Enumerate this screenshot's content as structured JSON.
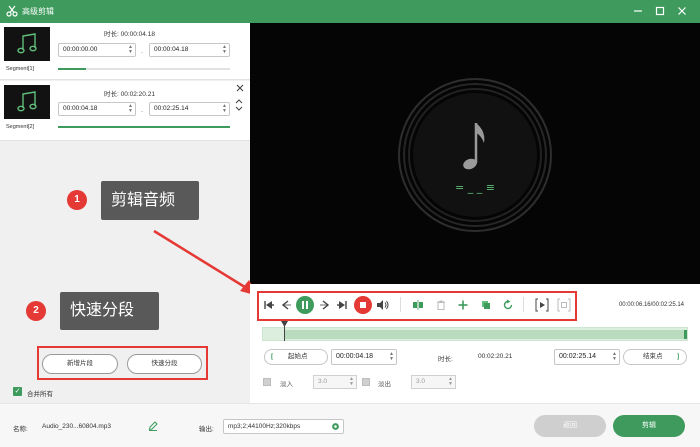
{
  "window": {
    "title": "高级剪辑"
  },
  "segments": [
    {
      "label": "Segment[1]",
      "duration_label": "时长: 00:00:04.18",
      "start": "00:00:00.00",
      "end": "00:00:04.18"
    },
    {
      "label": "Segment[2]",
      "duration_label": "时长: 00:02:20.21",
      "start": "00:00:04.18",
      "end": "00:02:25.14"
    }
  ],
  "annotations": {
    "callout1_number": "1",
    "callout1_text": "剪辑音频",
    "callout2_number": "2",
    "callout2_text": "快速分段"
  },
  "left_actions": {
    "add_segment": "新增片段",
    "quick_split": "快速分段",
    "merge_all": "合并所有"
  },
  "player": {
    "time_counter": "00:00:06.16/00:02:25.14",
    "note_bars": "= _ _ ≡"
  },
  "trim": {
    "start_point": "起始点",
    "start_value": "00:00:04.18",
    "duration_label": "时长:",
    "duration_value": "00:02:20.21",
    "end_value": "00:02:25.14",
    "end_point": "结束点"
  },
  "fade": {
    "fade_in_label": "淡入",
    "fade_in_value": "3.0",
    "fade_out_label": "淡出",
    "fade_out_value": "3.0"
  },
  "bottom": {
    "name_label": "名称:",
    "file_name": "Audio_230...60804.mp3",
    "output_label": "输出:",
    "output_value": "mp3;2;44100Hz;320kbps",
    "back_button": "返回",
    "cut_button": "剪辑"
  },
  "colors": {
    "accent": "#3e9b5d",
    "annotation_red": "#e53935",
    "callout_bg": "#595959"
  }
}
